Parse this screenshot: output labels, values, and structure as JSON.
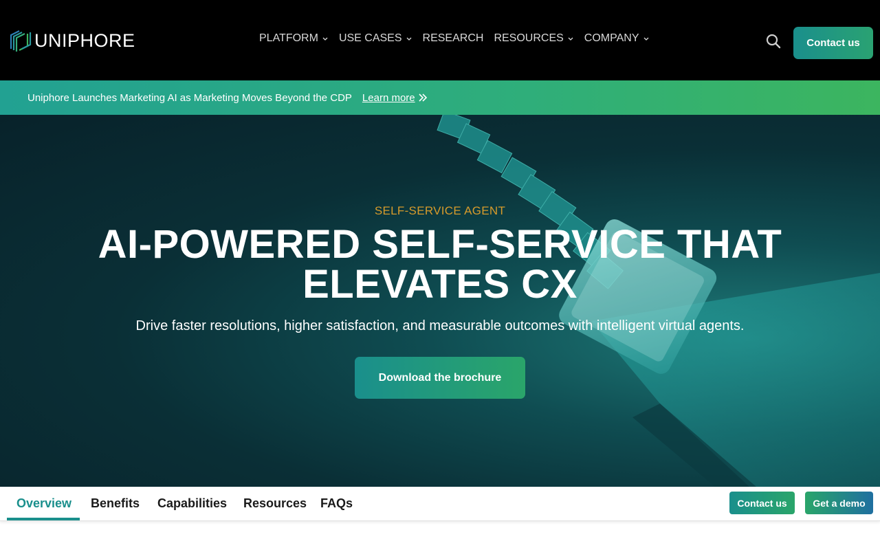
{
  "brand": {
    "name": "UNIPHORE"
  },
  "nav": {
    "items": [
      {
        "label": "PLATFORM",
        "has_dropdown": true
      },
      {
        "label": "USE CASES",
        "has_dropdown": true
      },
      {
        "label": "RESEARCH",
        "has_dropdown": false
      },
      {
        "label": "RESOURCES",
        "has_dropdown": true
      },
      {
        "label": "COMPANY",
        "has_dropdown": true
      }
    ],
    "search_icon": "search-icon",
    "contact_label": "Contact us"
  },
  "announcement": {
    "text": "Uniphore Launches Marketing AI as Marketing Moves Beyond the CDP",
    "link_label": "Learn more"
  },
  "hero": {
    "eyebrow": "SELF-SERVICE AGENT",
    "title": "AI-POWERED SELF-SERVICE THAT ELEVATES CX",
    "subtitle": "Drive faster resolutions, higher satisfaction, and measurable outcomes with intelligent virtual agents.",
    "cta_label": "Download the brochure"
  },
  "tabs": {
    "items": [
      {
        "label": "Overview",
        "active": true
      },
      {
        "label": "Benefits",
        "active": false
      },
      {
        "label": "Capabilities",
        "active": false
      },
      {
        "label": "Resources",
        "active": false
      },
      {
        "label": "FAQs",
        "active": false
      }
    ],
    "contact_label": "Contact us",
    "demo_label": "Get a demo"
  },
  "colors": {
    "accent_teal": "#1a8f8c",
    "accent_green": "#2aa56a",
    "eyebrow_gold": "#d79b2b",
    "header_bg": "#000000"
  }
}
